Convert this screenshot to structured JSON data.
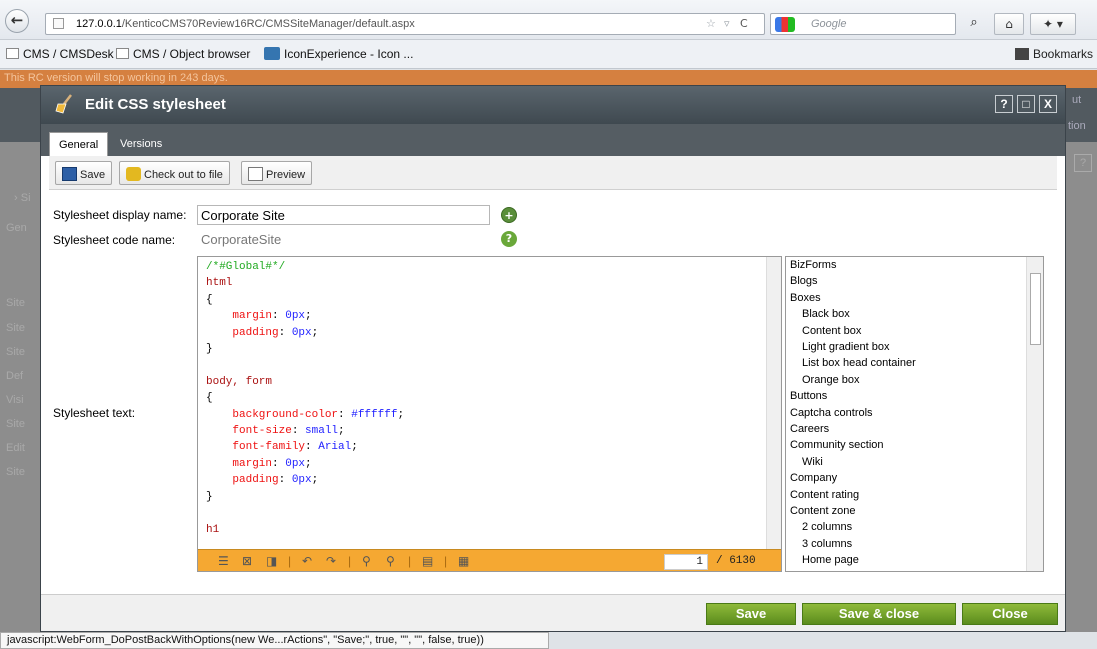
{
  "browser": {
    "url_host": "127.0.0.1",
    "url_path": "/KenticoCMS70Review16RC/CMSSiteManager/default.aspx",
    "search_placeholder": "Google",
    "bookmarks": [
      "CMS / CMSDesk",
      "CMS / Object browser",
      "IconExperience - Icon ..."
    ],
    "bookmarks_menu": "Bookmarks",
    "status_text": "javascript:WebForm_DoPostBackWithOptions(new We...rActions\", \"Save;\", true, \"\", \"\", false, true))"
  },
  "background": {
    "rc_notice": "This RC version will stop working in 243 days.",
    "left_items": [
      "Site",
      "Site",
      "Site",
      "Def",
      "Visi",
      "Site",
      "Edit",
      "Site"
    ],
    "breadcrumb": "Si",
    "tab": "Gen",
    "right_top": "ut",
    "right_mid": "tion",
    "right_help": "?"
  },
  "dialog": {
    "title": "Edit CSS stylesheet",
    "window_buttons": [
      "?",
      "□",
      "X"
    ],
    "tabs": [
      "General",
      "Versions"
    ],
    "actions": {
      "save": "Save",
      "checkout": "Check out to file",
      "preview": "Preview"
    },
    "form": {
      "display_name_label": "Stylesheet display name:",
      "display_name_value": "Corporate Site",
      "code_name_label": "Stylesheet code name:",
      "code_name_value": "CorporateSite",
      "text_label": "Stylesheet text:"
    },
    "editor": {
      "current_line": "1",
      "total_lines": "/ 6130"
    },
    "class_list": [
      {
        "text": "BizForms",
        "indent": false
      },
      {
        "text": "Blogs",
        "indent": false
      },
      {
        "text": "Boxes",
        "indent": false
      },
      {
        "text": "Black box",
        "indent": true
      },
      {
        "text": "Content box",
        "indent": true
      },
      {
        "text": "Light gradient box",
        "indent": true
      },
      {
        "text": "List box head container",
        "indent": true
      },
      {
        "text": "Orange box",
        "indent": true
      },
      {
        "text": "Buttons",
        "indent": false
      },
      {
        "text": "Captcha controls",
        "indent": false
      },
      {
        "text": "Careers",
        "indent": false
      },
      {
        "text": "Community section",
        "indent": false
      },
      {
        "text": "Wiki",
        "indent": true
      },
      {
        "text": "Company",
        "indent": false
      },
      {
        "text": "Content rating",
        "indent": false
      },
      {
        "text": "Content zone",
        "indent": false
      },
      {
        "text": "2 columns",
        "indent": true
      },
      {
        "text": "3 columns",
        "indent": true
      },
      {
        "text": "Home page",
        "indent": true
      }
    ],
    "footer": {
      "save": "Save",
      "save_close": "Save & close",
      "close": "Close"
    }
  }
}
